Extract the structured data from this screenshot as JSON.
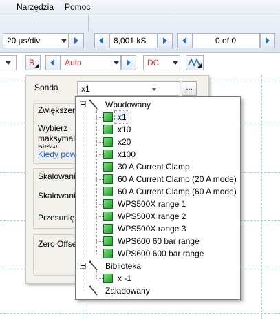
{
  "menu": {
    "items": [
      "Narzędzia",
      "Pomoc"
    ]
  },
  "toolbar": {
    "timebase_value": "20 µs/div",
    "samples_value": "8,001 kS",
    "capture_value": "0 of 0",
    "channel_letter": "B",
    "range_value": "Auto",
    "coupling_value": "DC",
    "colors": {
      "channel_b_red": "#e0302f",
      "accent_blue": "#2f6fb5"
    }
  },
  "panel": {
    "sonda_label": "Sonda",
    "sonda_value": "x1",
    "ellipsis_label": "...",
    "zwiekszenie_title": "Zwiększeni",
    "zwiekszenie_text_1": "Wybierz",
    "zwiekszenie_text_2": "maksymal",
    "zwiekszenie_text_3": "bitów",
    "zwiekszenie_link": "Kiedy pow",
    "skalowanie_title": "Skalowanie",
    "skalowanie_label": "Skalowanie",
    "przesuniecie_label": "Przesunięci",
    "zero_offset_title": "Zero Offset"
  },
  "tree": {
    "groups": [
      {
        "label": "Wbudowany",
        "items": [
          "x1",
          "x10",
          "x20",
          "x100",
          "30 A Current Clamp",
          "60 A Current Clamp (20 A mode)",
          "60 A Current Clamp (60 A mode)",
          "WPS500X range 1",
          "WPS500X range 2",
          "WPS500X range 3",
          "WPS600 60 bar range",
          "WPS600 600 bar range"
        ]
      },
      {
        "label": "Biblioteka",
        "items": [
          "x -1"
        ]
      },
      {
        "label": "Załadowany",
        "items": []
      }
    ]
  }
}
